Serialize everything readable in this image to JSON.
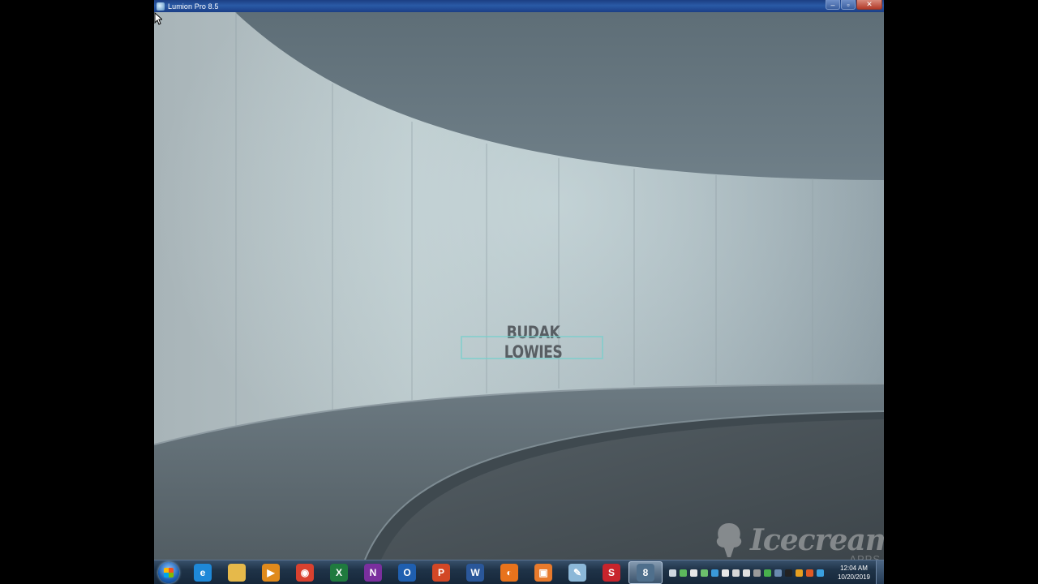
{
  "window": {
    "title": "Lumion Pro 8.5",
    "controls": {
      "minimize": "–",
      "maximize": "▫",
      "close": "✕"
    }
  },
  "splash": {
    "title": "BUDAK LOWIES",
    "box_accent_color": "#76d0cc"
  },
  "watermark": {
    "text": "Icecream",
    "sub": "APPS"
  },
  "taskbar": {
    "pinned": [
      {
        "name": "internet-explorer-icon",
        "glyph": "e",
        "color": "#1e88d8"
      },
      {
        "name": "file-explorer-icon",
        "glyph": "",
        "color": "#e6b94a"
      },
      {
        "name": "media-player-icon",
        "glyph": "▶",
        "color": "#e08a1c"
      },
      {
        "name": "chrome-icon",
        "glyph": "◉",
        "color": "#d9412f"
      },
      {
        "name": "excel-icon",
        "glyph": "X",
        "color": "#1f7a3e"
      },
      {
        "name": "onenote-icon",
        "glyph": "N",
        "color": "#7a2f9e"
      },
      {
        "name": "outlook-icon",
        "glyph": "O",
        "color": "#1f5fb0"
      },
      {
        "name": "powerpoint-icon",
        "glyph": "P",
        "color": "#d24726"
      },
      {
        "name": "word-icon",
        "glyph": "W",
        "color": "#2a579a"
      },
      {
        "name": "firefox-icon",
        "glyph": "◐",
        "color": "#e8731c"
      },
      {
        "name": "lumion-app-icon",
        "glyph": "▣",
        "color": "#e87a2c"
      },
      {
        "name": "notepad-icon",
        "glyph": "✎",
        "color": "#8cb8d8"
      },
      {
        "name": "sketchup-icon",
        "glyph": "S",
        "color": "#c8242c"
      },
      {
        "name": "lumion-active-icon",
        "glyph": "8",
        "color": "#4f6f8c"
      }
    ],
    "tray_colors": [
      "#cfd8e0",
      "#5cb85c",
      "#e8e8e8",
      "#6cc06c",
      "#3a9ad9",
      "#e8e8e8",
      "#d8d8d8",
      "#e0e0e0",
      "#9a9a9a",
      "#48b04c",
      "#6a8ab0",
      "#222222",
      "#e8a020",
      "#e05a24",
      "#3aa0e0"
    ],
    "clock": {
      "time": "12:04 AM",
      "date": "10/20/2019"
    }
  }
}
